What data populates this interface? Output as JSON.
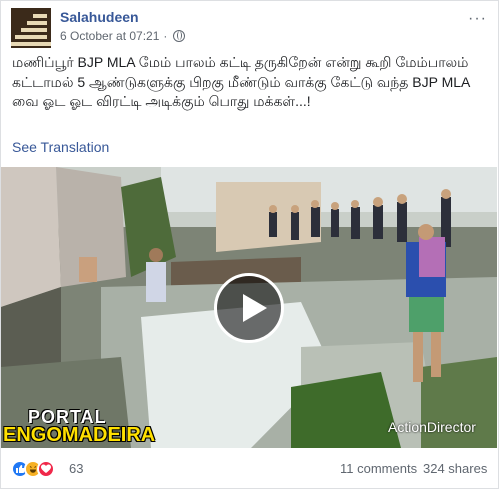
{
  "post": {
    "author": "Salahudeen",
    "timestamp": "6 October at 07:21",
    "separator": "·",
    "privacy_icon": "globe-icon",
    "more_options": "···",
    "text": "மணிப்பூர் BJP MLA மேம் பாலம் கட்டி தருகிறேன் என்று கூறி மேம்பாலம் கட்டாமல் 5 ஆண்டுகளுக்கு பிறகு மீண்டும் வாக்கு கேட்டு வந்த BJP MLA வை ஓட ஓட விரட்டி அடிக்கும் பொது மக்கள்...!",
    "see_translation": "See Translation"
  },
  "video": {
    "watermark_top": "PORTAL",
    "watermark_bottom": "ENGOMADEIRA",
    "watermark_right": "ActionDirector"
  },
  "footer": {
    "reactions": [
      "like-icon",
      "haha-icon",
      "love-icon"
    ],
    "reaction_count": "63",
    "comments": "11 comments",
    "shares": "324 shares"
  },
  "colors": {
    "link": "#385898",
    "text": "#1c1e21",
    "secondary": "#606770",
    "like": "#2078f4",
    "haha": "#f7b125",
    "love": "#f0284a"
  }
}
